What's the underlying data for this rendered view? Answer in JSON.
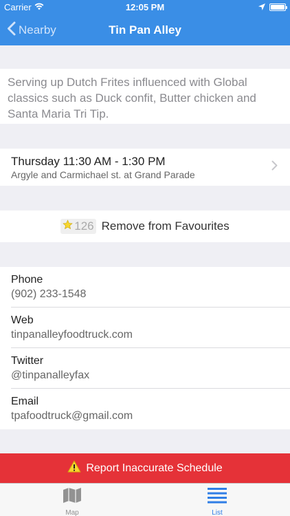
{
  "status": {
    "carrier": "Carrier",
    "time": "12:05 PM"
  },
  "nav": {
    "back_label": "Nearby",
    "title": "Tin Pan Alley"
  },
  "description": "Serving up Dutch Frites influenced with Global classics such as Duck confit, Butter chicken and Santa Maria Tri Tip.",
  "schedule": {
    "when": "Thursday 11:30 AM - 1:30 PM",
    "where": "Argyle and Carmichael st. at Grand Parade"
  },
  "favourite": {
    "count": "126",
    "label": "Remove from Favourites"
  },
  "contact": [
    {
      "key": "Phone",
      "value": "(902) 233-1548"
    },
    {
      "key": "Web",
      "value": "tinpanalleyfoodtruck.com"
    },
    {
      "key": "Twitter",
      "value": "@tinpanalleyfax"
    },
    {
      "key": "Email",
      "value": "tpafoodtruck@gmail.com"
    }
  ],
  "report": {
    "label": "Report Inaccurate Schedule"
  },
  "tabs": [
    {
      "label": "Map",
      "icon": "map-icon"
    },
    {
      "label": "List",
      "icon": "list-icon"
    }
  ],
  "colors": {
    "accent": "#3a8ee6",
    "report": "#e53238",
    "tab_active": "#2f7ee6"
  }
}
